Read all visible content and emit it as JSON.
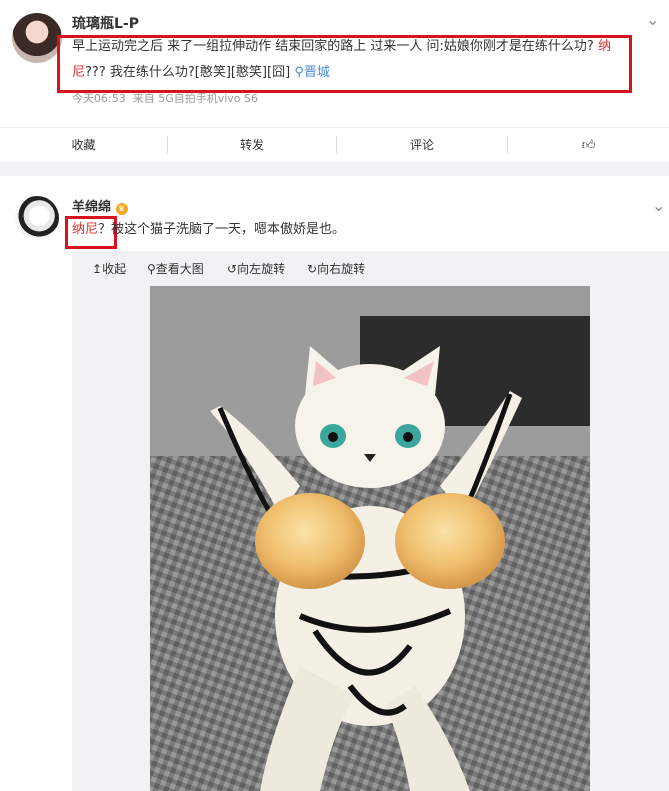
{
  "post1": {
    "username": "琉璃瓶L-P",
    "text_line1_a": "早上运动完之后 来了一组拉伸动作 结束回家的路上 过来一人 问:姑娘你刚才是在练什么功?",
    "text_red1": "纳",
    "text_red2": "尼",
    "text_line2": "??? 我在练什么功?[憨笑][憨笑][囧]",
    "location": "晋城",
    "time": "今天06:53",
    "source": "来自 5G自拍手机vivo S6"
  },
  "actions": {
    "collect": "收藏",
    "forward": "转发",
    "comment": "评论"
  },
  "post2": {
    "username": "羊绵绵",
    "highlight": "纳尼",
    "text": "？被这个猫子洗脑了一天，嗯本傲娇是也。"
  },
  "image_toolbar": {
    "collapse": "收起",
    "view_large": "查看大图",
    "rotate_left": "向左旋转",
    "rotate_right": "向右旋转"
  },
  "colors": {
    "highlight_red": "#e0312c",
    "box_red": "#d9121b",
    "location_blue": "#4a8ad3",
    "panel_bg": "#f2f2f5"
  }
}
